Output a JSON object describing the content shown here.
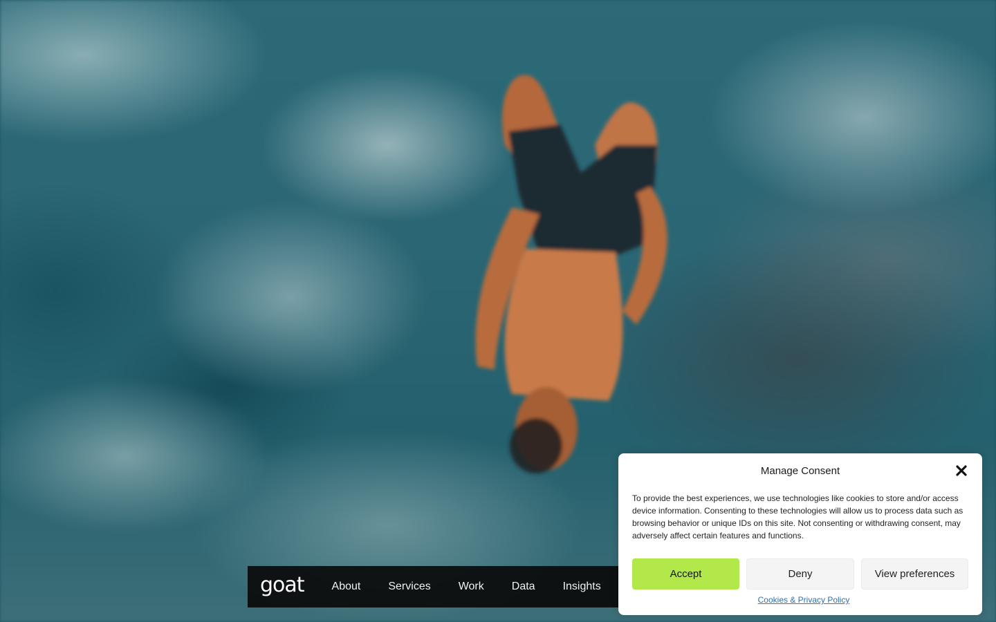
{
  "hero": {
    "image_description_icon": "cliff-diver-image"
  },
  "nav": {
    "logo": "goat",
    "links": [
      "About",
      "Services",
      "Work",
      "Data",
      "Insights"
    ]
  },
  "consent": {
    "title": "Manage Consent",
    "close_icon": "close-icon",
    "body": "To provide the best experiences, we use technologies like cookies to store and/or access device information. Consenting to these technologies will allow us to process data such as browsing behavior or unique IDs on this site. Not consenting or withdrawing consent, may adversely affect certain features and functions.",
    "accept_label": "Accept",
    "deny_label": "Deny",
    "preferences_label": "View preferences",
    "policy_link": "Cookies & Privacy Policy"
  },
  "colors": {
    "accept_bg": "#b2e84a",
    "nav_bg": "#0a0a0a",
    "link": "#2e6fb0"
  }
}
